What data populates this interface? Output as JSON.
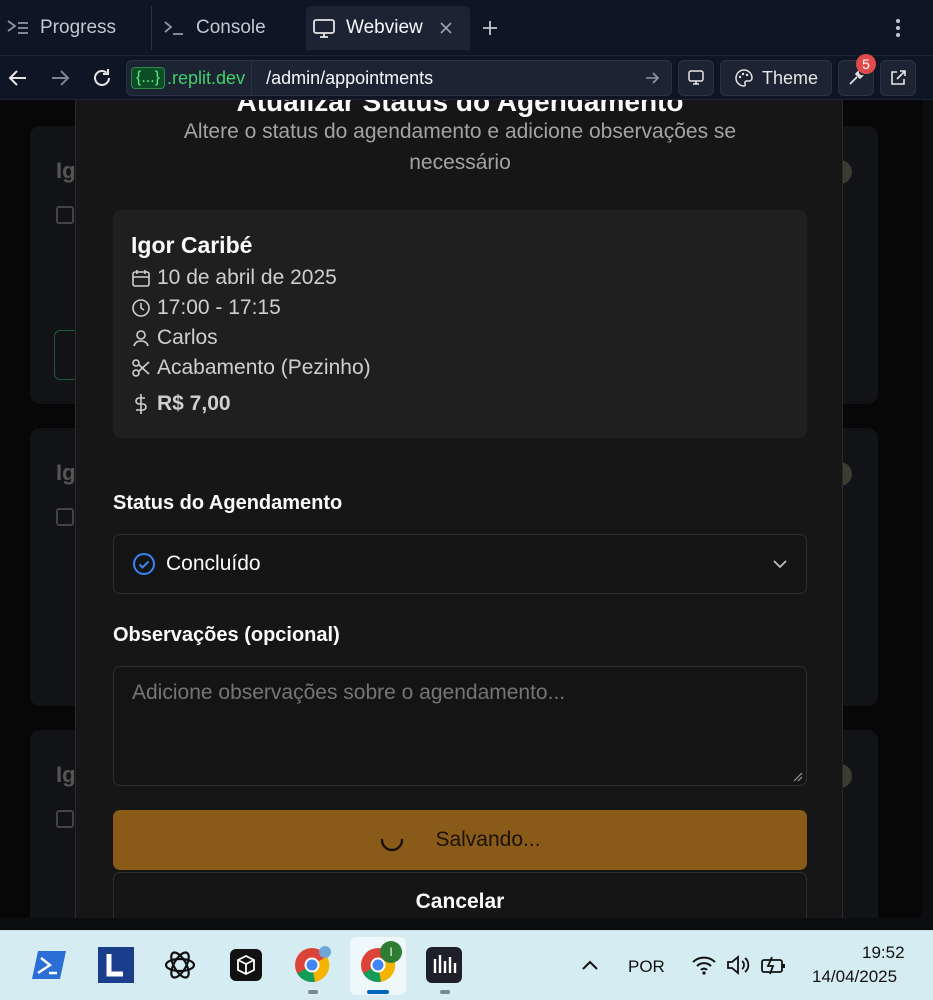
{
  "tabs": [
    {
      "label": "Progress",
      "icon": "progress-icon"
    },
    {
      "label": "Console",
      "icon": "console-icon"
    },
    {
      "label": "Webview",
      "icon": "monitor-icon",
      "active": true
    }
  ],
  "browser": {
    "domain_badge": "{...}",
    "domain": ".replit.dev",
    "path": "/admin/appointments",
    "theme_label": "Theme",
    "devtools_badge": "5"
  },
  "background_cards": [
    {
      "name_fragment": "Igo"
    },
    {
      "name_fragment": "Ig"
    },
    {
      "name_fragment": "Ig"
    }
  ],
  "modal": {
    "title": "Atualizar Status do Agendamento",
    "subtitle": "Altere o status do agendamento e adicione observações se necessário",
    "appointment": {
      "client": "Igor Caribé",
      "date": "10 de abril de 2025",
      "time": "17:00 - 17:15",
      "barber": "Carlos",
      "service": "Acabamento (Pezinho)",
      "price": "R$ 7,00"
    },
    "status_label": "Status do Agendamento",
    "status_value": "Concluído",
    "notes_label": "Observações (opcional)",
    "notes_placeholder": "Adicione observações sobre o agendamento...",
    "save_label": "Salvando...",
    "cancel_label": "Cancelar"
  },
  "taskbar": {
    "language": "POR",
    "time": "19:52",
    "date": "14/04/2025",
    "chrome_badge": "I"
  },
  "colors": {
    "accent_save": "#8a5a18",
    "status_check": "#3b82f6",
    "url_green": "#3ed06a"
  }
}
